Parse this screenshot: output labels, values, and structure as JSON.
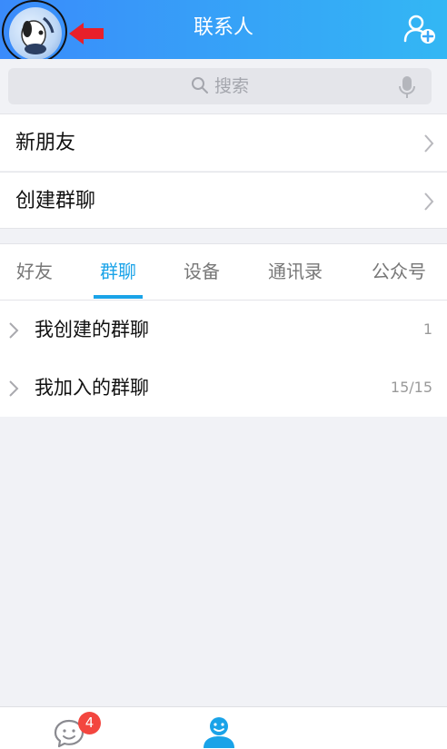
{
  "header": {
    "title": "联系人"
  },
  "search": {
    "placeholder": "搜索"
  },
  "menu": {
    "new_friends": "新朋友",
    "create_group": "创建群聊"
  },
  "tabs": [
    {
      "label": "好友",
      "active": false
    },
    {
      "label": "群聊",
      "active": true
    },
    {
      "label": "设备",
      "active": false
    },
    {
      "label": "通讯录",
      "active": false
    },
    {
      "label": "公众号",
      "active": false
    }
  ],
  "groups": [
    {
      "label": "我创建的群聊",
      "count": "1"
    },
    {
      "label": "我加入的群聊",
      "count": "15/15"
    }
  ],
  "bottom_nav": {
    "messages_badge": "4",
    "items": [
      {
        "icon": "chat-bubble-icon"
      },
      {
        "icon": "contacts-person-icon",
        "active": true
      }
    ]
  },
  "colors": {
    "header_start": "#3a8bfb",
    "header_end": "#33b7f4",
    "accent": "#1aa3e8",
    "badge": "#f3463f",
    "annotation_arrow": "#e8202a"
  }
}
